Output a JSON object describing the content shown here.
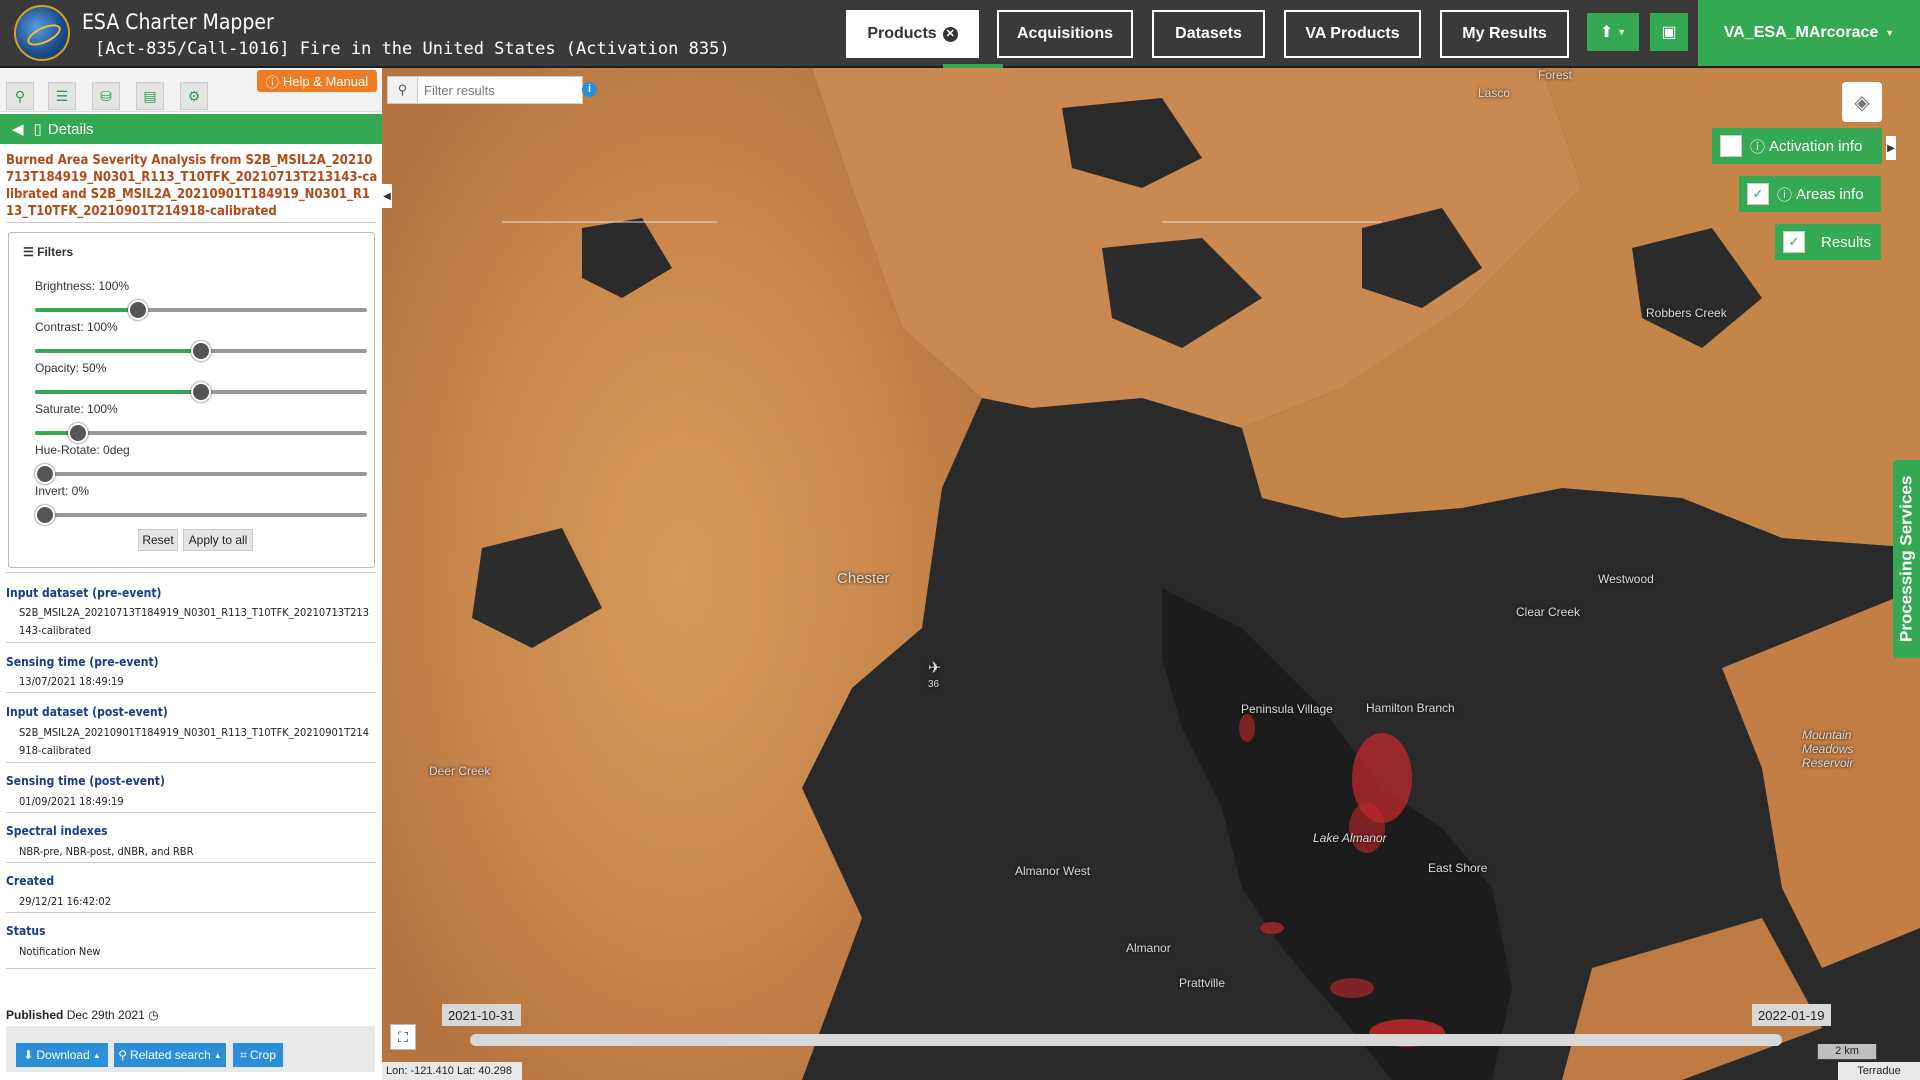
{
  "header": {
    "app_title": "ESA Charter Mapper",
    "subtitle": "[Act-835/Call-1016] Fire in the United States (Activation 835)",
    "nav": {
      "products": "Products",
      "acquisitions": "Acquisitions",
      "datasets": "Datasets",
      "va_products": "VA Products",
      "my_results": "My Results"
    },
    "user": "VA_ESA_MArcorace"
  },
  "sidebar": {
    "help_label": "Help & Manual",
    "details_label": "Details",
    "product_title": "Burned Area Severity Analysis from S2B_MSIL2A_20210713T184919_N0301_R113_T10TFK_20210713T213143-calibrated and S2B_MSIL2A_20210901T184919_N0301_R113_T10TFK_20210901T214918-calibrated",
    "filters": {
      "title": "Filters",
      "items": [
        {
          "label": "Brightness: 100%",
          "fraction": 0.31
        },
        {
          "label": "Contrast: 100%",
          "fraction": 0.5
        },
        {
          "label": "Opacity: 50%",
          "fraction": 0.5
        },
        {
          "label": "Saturate: 100%",
          "fraction": 0.13
        },
        {
          "label": "Hue-Rotate: 0deg",
          "fraction": 0.0
        },
        {
          "label": "Invert: 0%",
          "fraction": 0.0
        }
      ],
      "reset": "Reset",
      "apply_all": "Apply to all"
    },
    "details": [
      {
        "label": "Input dataset (pre-event)",
        "value": "S2B_MSIL2A_20210713T184919_N0301_R113_T10TFK_20210713T213143-calibrated"
      },
      {
        "label": "Sensing time (pre-event)",
        "value": "13/07/2021 18:49:19"
      },
      {
        "label": "Input dataset (post-event)",
        "value": "S2B_MSIL2A_20210901T184919_N0301_R113_T10TFK_20210901T214918-calibrated"
      },
      {
        "label": "Sensing time (post-event)",
        "value": "01/09/2021 18:49:19"
      },
      {
        "label": "Spectral indexes",
        "value": "NBR-pre, NBR-post, dNBR, and RBR"
      },
      {
        "label": "Created",
        "value": "29/12/21 16:42:02"
      },
      {
        "label": "Status",
        "value": "Notification New"
      }
    ],
    "published_label": "Published",
    "published_date": "Dec 29th 2021",
    "download": "Download",
    "related_search": "Related search",
    "crop": "Crop"
  },
  "map": {
    "filter_placeholder": "Filter results",
    "activation_info": "Activation info",
    "areas_info": "Areas info",
    "results": "Results",
    "processing_services": "Processing Services",
    "date_start": "2021-10-31",
    "date_end": "2022-01-19",
    "scale_label": "2 km",
    "coords": "Lon: -121.410 Lat: 40.298",
    "attribution": "Terradue",
    "places": {
      "forest": "Forest",
      "lasco": "Lasco",
      "robbers_creek": "Robbers Creek",
      "chester": "Chester",
      "westwood": "Westwood",
      "clear_creek": "Clear Creek",
      "peninsula_village": "Peninsula Village",
      "hamilton_branch": "Hamilton Branch",
      "deer_creek": "Deer Creek",
      "lake_almanor": "Lake Almanor",
      "almanor_west": "Almanor West",
      "east_shore": "East Shore",
      "almanor": "Almanor",
      "prattville": "Prattville",
      "mountain_meadows": "Mountain Meadows Reservoir",
      "route_36": "36"
    }
  },
  "colors": {
    "accent_green": "#34a853",
    "orange": "#f07c22",
    "title_brown": "#b24a16",
    "label_blue": "#1a3c8a",
    "burn_red": "#c0282b"
  }
}
